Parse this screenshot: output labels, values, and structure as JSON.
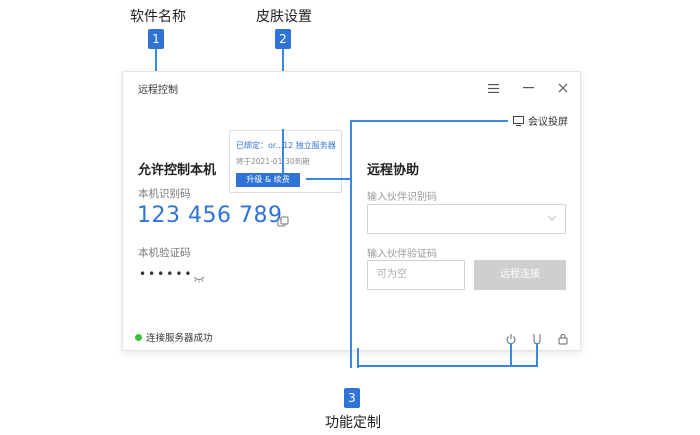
{
  "callouts": [
    {
      "number": "1",
      "label": "软件名称"
    },
    {
      "number": "2",
      "label": "皮肤设置"
    },
    {
      "number": "3",
      "label": "功能定制"
    }
  ],
  "window": {
    "title": "远程控制",
    "controls": [
      "menu-icon",
      "minimize-icon",
      "close-icon"
    ]
  },
  "promo": {
    "bound_text": "已绑定：or...12 独立服务器",
    "expire_text": "将于2021-01-30到期",
    "button_label": "升级 & 续费"
  },
  "left": {
    "title": "允许控制本机",
    "id_label": "本机识别码",
    "id_value": "123 456 789",
    "code_label": "本机验证码",
    "code_value": "••••••"
  },
  "right": {
    "meeting_label": "会议投屏",
    "title": "远程协助",
    "partner_id_label": "输入伙伴识别码",
    "partner_code_label": "输入伙伴验证码",
    "partner_code_placeholder": "可为空",
    "connect_label": "远程连接"
  },
  "footer": {
    "status_text": "连接服务器成功",
    "icons": [
      "power-icon",
      "usb-icon",
      "lock-icon"
    ]
  },
  "colors": {
    "accent": "#2f73d9",
    "status_ok": "#3cc13b",
    "disabled_button": "#cfcfcf"
  }
}
